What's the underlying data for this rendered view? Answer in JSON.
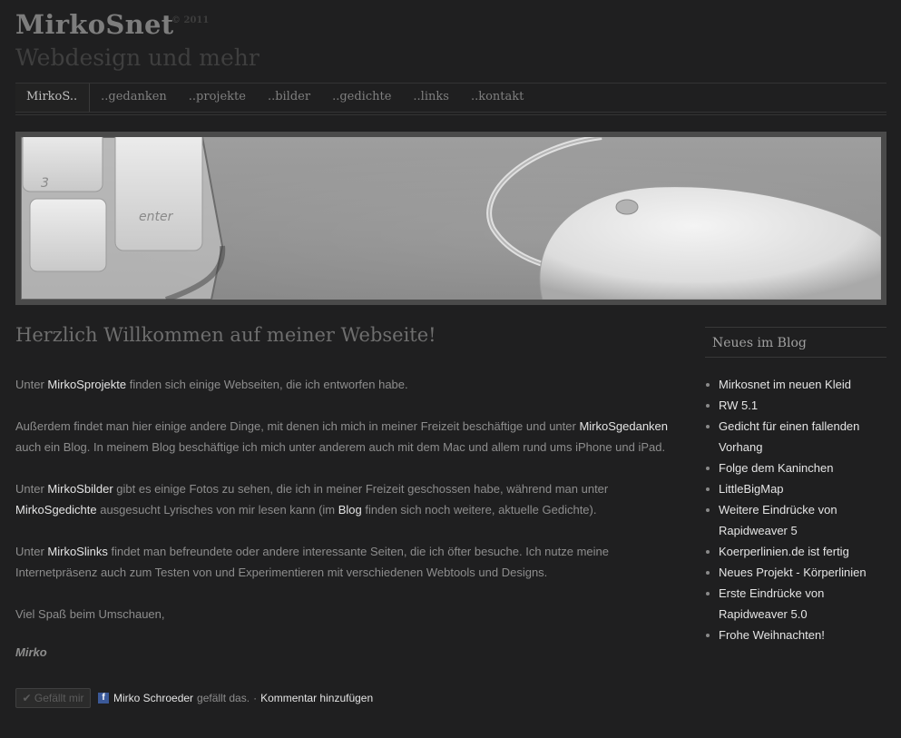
{
  "header": {
    "title": "MirkoSnet",
    "copyright": "© 2011",
    "tagline": "Webdesign und mehr"
  },
  "nav": {
    "items": [
      "MirkoS..",
      "..gedanken",
      "..projekte",
      "..bilder",
      "..gedichte",
      "..links",
      "..kontakt"
    ],
    "active_index": 0
  },
  "main": {
    "welcome": "Herzlich Willkommen auf meiner Webseite!",
    "p1": {
      "a": "Unter ",
      "link1": "MirkoSprojekte",
      "b": " finden sich einige Webseiten, die ich entworfen habe."
    },
    "p2": {
      "a": "Außerdem findet man hier einige andere Dinge, mit denen ich mich in meiner Freizeit beschäftige und unter ",
      "link1": "MirkoSgedanken",
      "b": " auch ein Blog. In meinem Blog beschäftige ich mich unter anderem auch mit dem Mac und allem rund ums iPhone und iPad."
    },
    "p3": {
      "a": "Unter ",
      "link1": "MirkoSbilder",
      "b": " gibt es einige Fotos zu sehen, die ich in meiner Freizeit geschossen habe, während man unter ",
      "link2": "MirkoSgedichte",
      "c": " ausgesucht Lyrisches von mir lesen kann (im ",
      "link3": "Blog",
      "d": " finden sich noch weitere, aktuelle Gedichte)."
    },
    "p4": {
      "a": "Unter ",
      "link1": "MirkoSlinks",
      "b": " findet man befreundete oder andere interessante Seiten, die ich öfter besuche. Ich nutze meine Internetpräsenz auch zum Testen von und Experimentieren mit verschiedenen Webtools und Designs."
    },
    "p5": "Viel Spaß beim Umschauen,",
    "signature": "Mirko"
  },
  "facebook": {
    "like_button": "✔ Gefällt mir",
    "logo": "f",
    "user": "Mirko Schroeder",
    "likes_text": "gefällt das.",
    "separator": "·",
    "comment_link": "Kommentar hinzufügen"
  },
  "sidebar": {
    "title": "Neues im Blog",
    "items": [
      "Mirkosnet im neuen Kleid",
      "RW 5.1",
      "Gedicht für einen fallenden Vorhang",
      "Folge dem Kaninchen",
      "LittleBigMap",
      "Weitere Eindrücke von Rapidweaver 5",
      "Koerperlinien.de ist fertig",
      "Neues Projekt - Körperlinien",
      "Erste Eindrücke von Rapidweaver 5.0",
      "Frohe Weihnachten!"
    ]
  },
  "hero": {
    "key_label": "enter",
    "key_number": "3"
  }
}
